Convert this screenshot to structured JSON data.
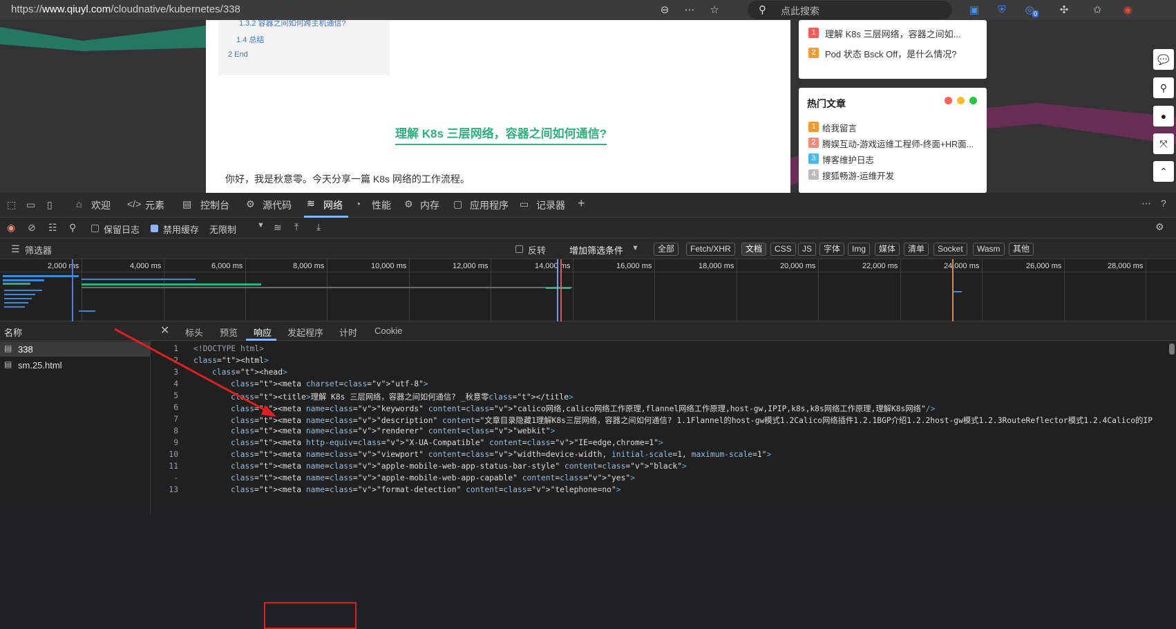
{
  "addressbar": {
    "url_prefix": "https://",
    "url_domain": "www.qiuyl.com",
    "url_path": "/cloudnative/kubernetes/338",
    "search_placeholder": "点此搜索",
    "badge_count": "0"
  },
  "article": {
    "toc": [
      {
        "label": "1.3.2  容器之间如何跨主机通信?"
      },
      {
        "label": "1.4  总结"
      },
      {
        "label": "2  End"
      }
    ],
    "title": "理解 K8s 三层网络，容器之间如何通信?",
    "intro": "你好，我是秋意零。今天分享一篇 K8s 网络的工作流程。"
  },
  "sidebar": {
    "latest_items": [
      {
        "rank": "1",
        "label": "理解 K8s 三层网络，容器之间如...",
        "color": "#f25c5c"
      },
      {
        "rank": "2",
        "label": "Pod 状态 Bsck Off，是什么情况?",
        "color": "#f29a35"
      }
    ],
    "hot_title": "热门文章",
    "hot_items": [
      {
        "rank": "1",
        "label": "给我留言",
        "color": "#f29a35"
      },
      {
        "rank": "2",
        "label": "腾娱互动-游戏运维工程师-终面+HR面...",
        "color": "#f28a75"
      },
      {
        "rank": "3",
        "label": "博客维护日志",
        "color": "#4fb8e8"
      },
      {
        "rank": "4",
        "label": "搜狐畅游-运维开发",
        "color": "#bbbbbb"
      }
    ],
    "dot_colors": [
      "#ff5f57",
      "#febc2e",
      "#28c840"
    ]
  },
  "devtools": {
    "tabs": [
      "欢迎",
      "元素",
      "控制台",
      "源代码",
      "网络",
      "性能",
      "内存",
      "应用程序",
      "记录器"
    ],
    "active_tab": "网络",
    "toolbar": {
      "preserve_log": "保留日志",
      "disable_cache": "禁用缓存",
      "throttle": "无限制"
    },
    "filter": {
      "placeholder": "筛选器",
      "invert": "反转",
      "more_filters": "增加筛选条件",
      "types": [
        "全部",
        "Fetch/XHR",
        "文档",
        "CSS",
        "JS",
        "字体",
        "Img",
        "媒体",
        "清单",
        "Socket",
        "Wasm",
        "其他"
      ],
      "selected_type": "文档"
    },
    "timeline_ticks": [
      "2,000 ms",
      "4,000 ms",
      "6,000 ms",
      "8,000 ms",
      "10,000 ms",
      "12,000 ms",
      "14,000 ms",
      "16,000 ms",
      "18,000 ms",
      "20,000 ms",
      "22,000 ms",
      "24,000 ms",
      "26,000 ms",
      "28,000 ms"
    ],
    "requests_header": "名称",
    "requests": [
      "338",
      "sm.25.html"
    ],
    "detail_tabs": [
      "标头",
      "预览",
      "响应",
      "发起程序",
      "计时",
      "Cookie"
    ],
    "active_detail_tab": "响应",
    "code_lines": [
      {
        "n": "1",
        "text": "<!DOCTYPE html>"
      },
      {
        "n": "2",
        "text": "<html>"
      },
      {
        "n": "3",
        "text": "<head>"
      },
      {
        "n": "4",
        "text": "<meta charset=\"utf-8\">"
      },
      {
        "n": "5",
        "text": "<title>理解 K8s 三层网络，容器之间如何通信? _秋意零</title>"
      },
      {
        "n": "6",
        "text": "<meta name=\"keywords\" content=\"calico网络,calico网络工作原理,flannel网络工作原理,host-gw,IPIP,k8s,k8s网络工作原理,理解K8s网络\"/>"
      },
      {
        "n": "7",
        "text": "<meta name=\"description\" content=\"文章目录隐藏1理解K8s三层网络，容器之间如何通信? 1.1Flannel的host-gw模式1.2Calico网络插件1.2.1BGP介绍1.2.2host-gw模式1.2.3RouteReflector模式1.2.4Calico的IP"
      },
      {
        "n": "8",
        "text": "<meta name=\"renderer\" content=\"webkit\">"
      },
      {
        "n": "9",
        "text": "<meta http-equiv=\"X-UA-Compatible\" content=\"IE=edge,chrome=1\">"
      },
      {
        "n": "10",
        "text": "<meta name=\"viewport\" content=\"width=device-width, initial-scale=1, maximum-scale=1\">"
      },
      {
        "n": "11",
        "text": "<meta name=\"apple-mobile-web-app-status-bar-style\" content=\"black\">"
      },
      {
        "n": "-",
        "text": "<meta name=\"apple-mobile-web-app-capable\" content=\"yes\">"
      },
      {
        "n": "13",
        "text": "<meta name=\"format-detection\" content=\"telephone=no\">"
      }
    ]
  }
}
